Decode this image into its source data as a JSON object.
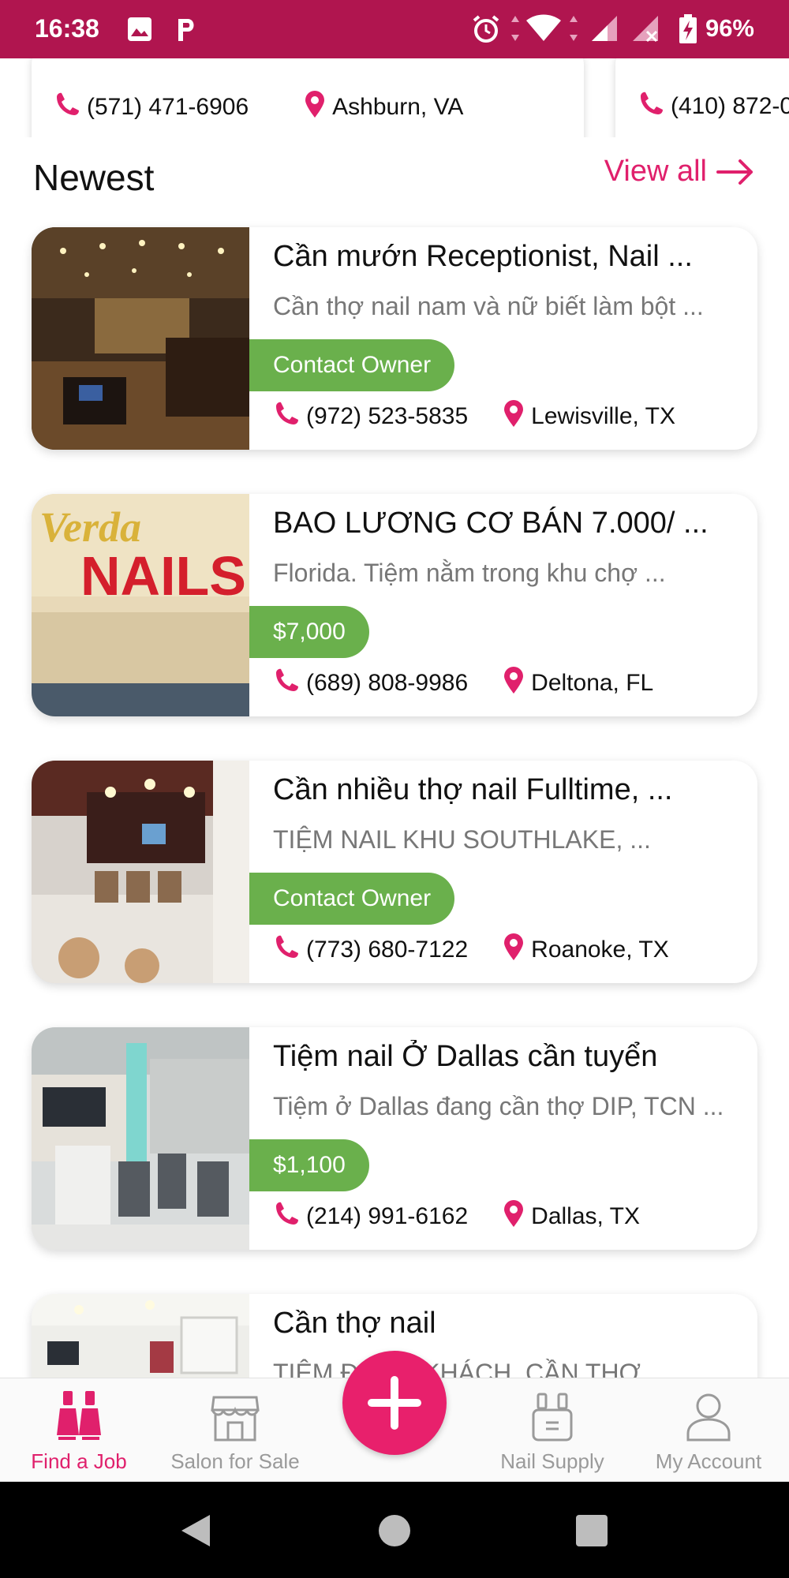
{
  "status_bar": {
    "time": "16:38",
    "battery_percent": "96%",
    "icons": [
      "image-icon",
      "p-app-icon",
      "alarm-icon",
      "wifi-icon",
      "cell-signal-icon",
      "battery-charging-icon"
    ]
  },
  "top_cards": [
    {
      "phone": "(571) 471-6906",
      "location": "Ashburn, VA"
    },
    {
      "phone": "(410) 872-0"
    }
  ],
  "section": {
    "title": "Newest",
    "view_all": "View all"
  },
  "listings": [
    {
      "title": "Cần mướn Receptionist, Nail ...",
      "description": "Cần thợ nail nam và nữ biết làm bột ...",
      "badge": "Contact Owner",
      "phone": "(972) 523-5835",
      "location": "Lewisville, TX"
    },
    {
      "title": "BAO LƯƠNG CƠ BÁN 7.000/ ...",
      "description": "Florida. Tiệm nằm trong khu chợ ...",
      "badge": "$7,000",
      "phone": "(689) 808-9986",
      "location": "Deltona, FL",
      "image_text_1": "Verda",
      "image_text_2": "NAILS"
    },
    {
      "title": "Cần nhiều thợ nail Fulltime, ...",
      "description": "TIỆM NAIL KHU SOUTHLAKE, ...",
      "badge": "Contact Owner",
      "phone": "(773) 680-7122",
      "location": "Roanoke, TX"
    },
    {
      "title": "Tiệm nail Ở Dallas cần tuyển",
      "description": "Tiệm ở Dallas đang cần thợ DIP, TCN ...",
      "badge": "$1,100",
      "phone": "(214) 991-6162",
      "location": "Dallas, TX"
    },
    {
      "title": "Cần thợ nail",
      "description": "TIỆM ĐÔNG KHÁCH, CẦN THỢ"
    }
  ],
  "bottom_nav": {
    "items": [
      {
        "label": "Find a Job",
        "icon": "nail-polish-icon",
        "active": true
      },
      {
        "label": "Salon for Sale",
        "icon": "storefront-icon",
        "active": false
      },
      {
        "label": "Nail Supply",
        "icon": "nail-supply-icon",
        "active": false
      },
      {
        "label": "My Account",
        "icon": "user-icon",
        "active": false
      }
    ],
    "fab_icon": "plus-icon"
  },
  "system_nav": [
    "back-icon",
    "home-icon",
    "recents-icon"
  ],
  "colors": {
    "status_bar": "#b0154f",
    "accent": "#e0206c",
    "badge_green": "#6ab04c",
    "fab": "#e8206c"
  }
}
